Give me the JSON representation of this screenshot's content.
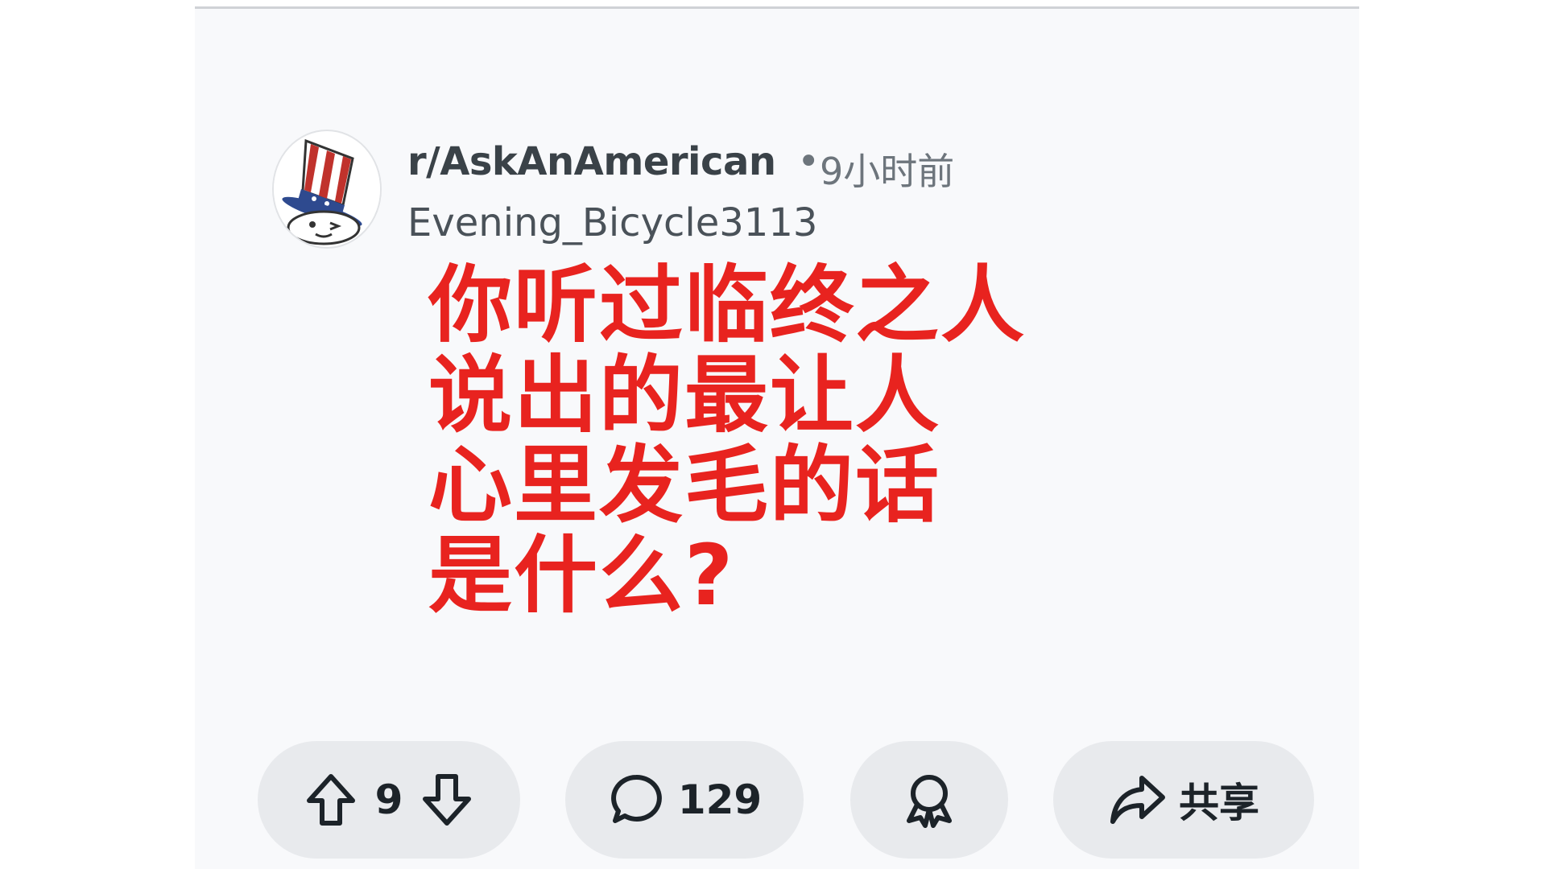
{
  "post": {
    "subreddit": "r/AskAnAmerican",
    "separator": "•",
    "time_ago": "9小时前",
    "author": "Evening_Bicycle3113",
    "title_lines": [
      "你听过临终之人",
      "说出的最让人",
      "心里发毛的话",
      "是什么?"
    ],
    "title_color": "#e8231f"
  },
  "actions": {
    "upvote_icon": "upvote-arrow-icon",
    "vote_count": "9",
    "downvote_icon": "downvote-arrow-icon",
    "comment_icon": "comment-bubble-icon",
    "comment_count": "129",
    "award_icon": "award-ribbon-icon",
    "share_icon": "share-arrow-icon",
    "share_label": "共享"
  },
  "avatar": {
    "icon": "uncle-sam-hat-snoo-icon"
  }
}
